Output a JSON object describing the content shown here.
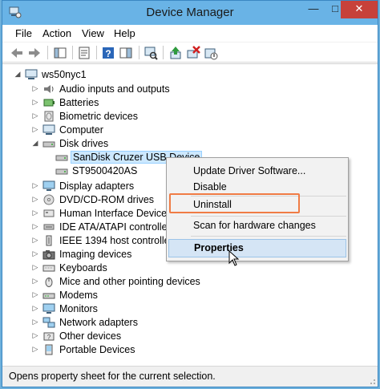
{
  "window": {
    "title": "Device Manager"
  },
  "menubar": {
    "items": [
      "File",
      "Action",
      "View",
      "Help"
    ]
  },
  "tree": {
    "root": "ws50nyc1",
    "items": [
      {
        "label": "Audio inputs and outputs",
        "icon": "speaker-icon"
      },
      {
        "label": "Batteries",
        "icon": "battery-icon"
      },
      {
        "label": "Biometric devices",
        "icon": "fingerprint-icon"
      },
      {
        "label": "Computer",
        "icon": "computer-icon"
      },
      {
        "label": "Disk drives",
        "icon": "disk-drive-icon",
        "expanded": true
      },
      {
        "label": "SanDisk Cruzer USB Device",
        "icon": "usb-drive-icon",
        "child": true,
        "selected": true
      },
      {
        "label": "ST9500420AS",
        "icon": "hard-drive-icon",
        "child": true
      },
      {
        "label": "Display adapters",
        "icon": "display-icon"
      },
      {
        "label": "DVD/CD-ROM drives",
        "icon": "dvd-icon"
      },
      {
        "label": "Human Interface Devices",
        "icon": "hid-icon"
      },
      {
        "label": "IDE ATA/ATAPI controllers",
        "icon": "ide-icon"
      },
      {
        "label": "IEEE 1394 host controllers",
        "icon": "firewire-icon"
      },
      {
        "label": "Imaging devices",
        "icon": "camera-icon"
      },
      {
        "label": "Keyboards",
        "icon": "keyboard-icon"
      },
      {
        "label": "Mice and other pointing devices",
        "icon": "mouse-icon"
      },
      {
        "label": "Modems",
        "icon": "modem-icon"
      },
      {
        "label": "Monitors",
        "icon": "monitor-icon"
      },
      {
        "label": "Network adapters",
        "icon": "network-icon"
      },
      {
        "label": "Other devices",
        "icon": "unknown-device-icon"
      },
      {
        "label": "Portable Devices",
        "icon": "portable-device-icon"
      }
    ]
  },
  "context_menu": {
    "update": "Update Driver Software...",
    "disable": "Disable",
    "uninstall": "Uninstall",
    "scan": "Scan for hardware changes",
    "properties": "Properties"
  },
  "status": {
    "text": "Opens property sheet for the current selection."
  },
  "colors": {
    "titlebar": "#69b3e6",
    "close": "#c7413a",
    "highlight_box": "#f07c45"
  }
}
